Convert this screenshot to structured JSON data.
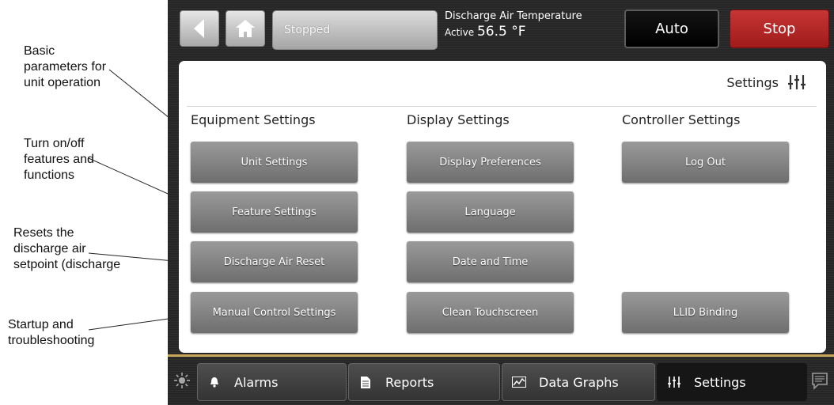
{
  "annotations": [
    {
      "id": "basic",
      "lines": [
        "Basic",
        "parameters for",
        "unit operation"
      ]
    },
    {
      "id": "turn",
      "lines": [
        "Turn on/off",
        "features and",
        "functions"
      ]
    },
    {
      "id": "resets",
      "lines": [
        "Resets the",
        "discharge air",
        "setpoint (discharge"
      ]
    },
    {
      "id": "startup",
      "lines": [
        "Startup and",
        "troubleshooting"
      ]
    }
  ],
  "topbar": {
    "status": "Stopped",
    "discharge_label": "Discharge Air Temperature",
    "active_label": "Active",
    "active_value": "56.5 °F",
    "auto_label": "Auto",
    "stop_label": "Stop"
  },
  "panel": {
    "title": "Settings",
    "columns": [
      {
        "heading": "Equipment Settings",
        "buttons": [
          "Unit Settings",
          "Feature Settings",
          "Discharge Air Reset",
          "Manual Control Settings"
        ]
      },
      {
        "heading": "Display Settings",
        "buttons": [
          "Display Preferences",
          "Language",
          "Date and Time",
          "Clean Touchscreen"
        ]
      },
      {
        "heading": "Controller Settings",
        "buttons": [
          "Log Out",
          "LLID Binding"
        ]
      }
    ]
  },
  "bottom_nav": {
    "tabs": [
      {
        "label": "Alarms",
        "icon": "bell-icon"
      },
      {
        "label": "Reports",
        "icon": "document-icon"
      },
      {
        "label": "Data Graphs",
        "icon": "chart-icon"
      },
      {
        "label": "Settings",
        "icon": "sliders-icon",
        "active": true
      }
    ]
  },
  "colors": {
    "stop": "#b42828",
    "auto": "#000000",
    "accent_line": "#c9a65a",
    "device_bg": "#2b2b2b"
  }
}
